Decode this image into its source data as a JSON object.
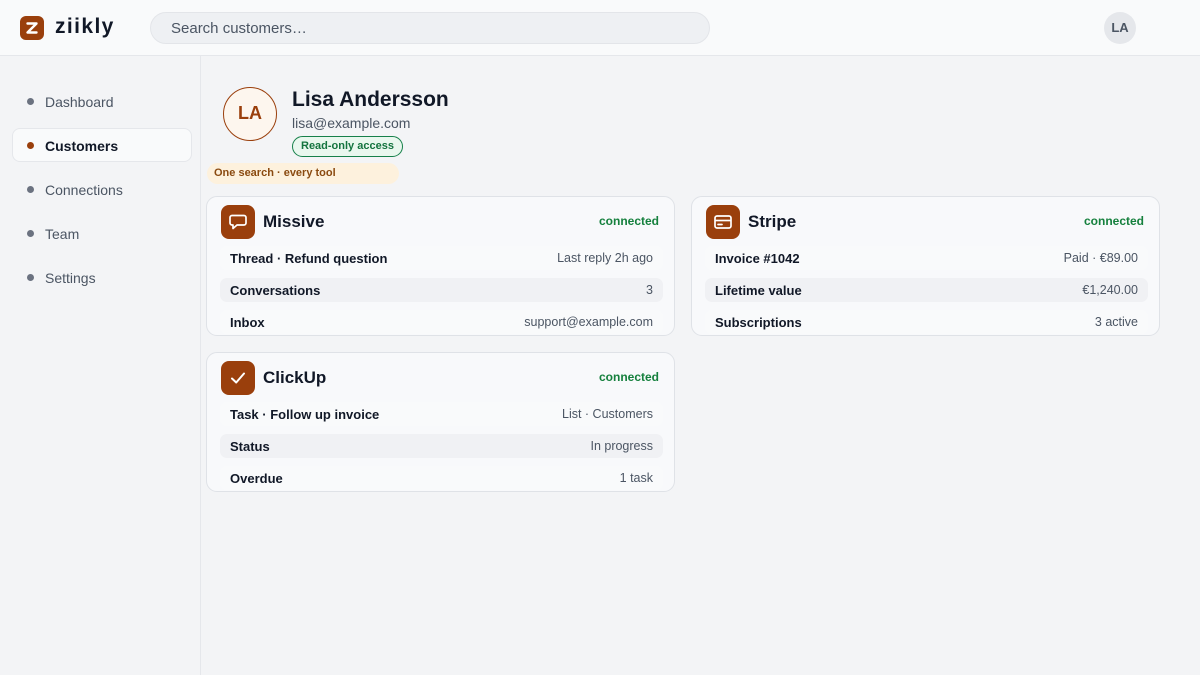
{
  "app": {
    "brand": "ziikly"
  },
  "search": {
    "placeholder": "Search customers…"
  },
  "user": {
    "initials": "LA"
  },
  "sidebar": {
    "items": [
      {
        "label": "Dashboard",
        "active": false
      },
      {
        "label": "Customers",
        "active": true
      },
      {
        "label": "Connections",
        "active": false
      },
      {
        "label": "Team",
        "active": false
      },
      {
        "label": "Settings",
        "active": false
      }
    ]
  },
  "customer": {
    "initials": "LA",
    "name": "Lisa Andersson",
    "email": "lisa@example.com",
    "badge": "Read-only access"
  },
  "tagline": "One search · every tool",
  "cards": [
    {
      "name": "Missive",
      "icon": "chat-bubble-icon",
      "status": "connected",
      "rows": [
        {
          "key": "Thread · Refund question",
          "value": "Last reply 2h ago"
        },
        {
          "key": "Conversations",
          "value": "3"
        },
        {
          "key": "Inbox",
          "value": "support@example.com"
        }
      ]
    },
    {
      "name": "Stripe",
      "icon": "credit-card-icon",
      "status": "connected",
      "rows": [
        {
          "key": "Invoice #1042",
          "value": "Paid · €89.00"
        },
        {
          "key": "Lifetime value",
          "value": "€1,240.00"
        },
        {
          "key": "Subscriptions",
          "value": "3 active"
        }
      ]
    },
    {
      "name": "ClickUp",
      "icon": "checkmark-icon",
      "status": "connected",
      "rows": [
        {
          "key": "Task · Follow up invoice",
          "value": "List · Customers"
        },
        {
          "key": "Status",
          "value": "In progress"
        },
        {
          "key": "Overdue",
          "value": "1 task"
        }
      ]
    }
  ],
  "colors": {
    "accent": "#9a3f0c",
    "connected": "#15803d",
    "badge_bg": "#e9f7ee",
    "tagline_bg": "#fdf1dd"
  }
}
